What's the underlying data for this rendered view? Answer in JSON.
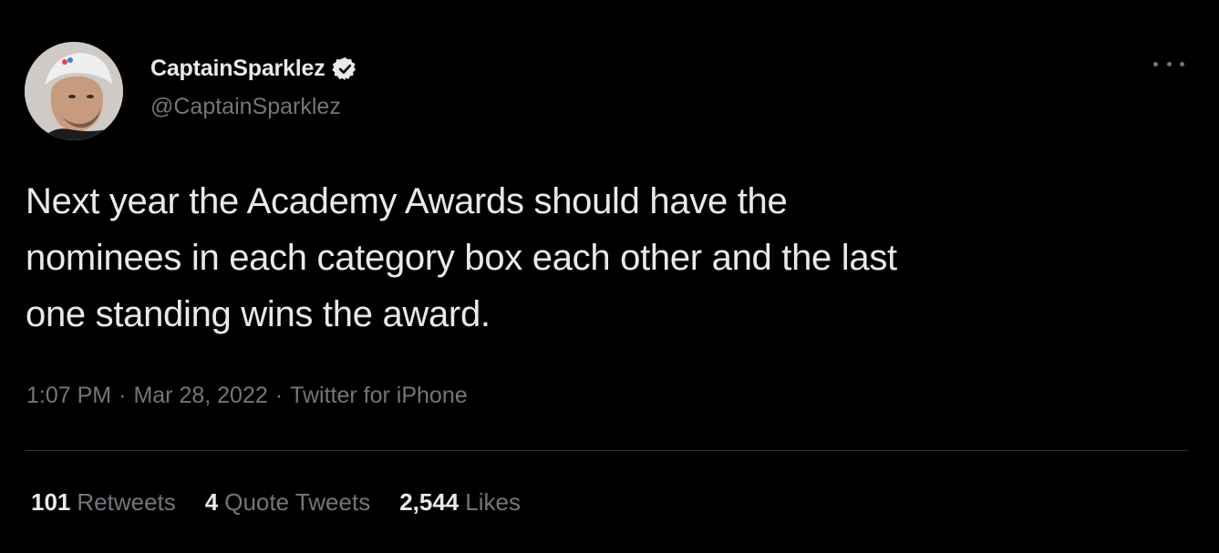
{
  "user": {
    "display_name": "CaptainSparklez",
    "handle": "@CaptainSparklez",
    "verified": true
  },
  "tweet": {
    "text_lines": [
      "Next year the Academy Awards should have the",
      "nominees in each category box each other and the last",
      "one standing wins the award."
    ],
    "time": "1:07 PM",
    "date": "Mar 28, 2022",
    "source": "Twitter for iPhone",
    "separator": "·"
  },
  "stats": {
    "retweets_count": "101",
    "retweets_label": "Retweets",
    "quotes_count": "4",
    "quotes_label": "Quote Tweets",
    "likes_count": "2,544",
    "likes_label": "Likes"
  },
  "icons": {
    "verified": "verified-badge-icon",
    "more": "more-options-icon"
  },
  "colors": {
    "background": "#000000",
    "primary_text": "#e7e9ea",
    "secondary_text": "#71767b",
    "divider": "#2f3336"
  }
}
